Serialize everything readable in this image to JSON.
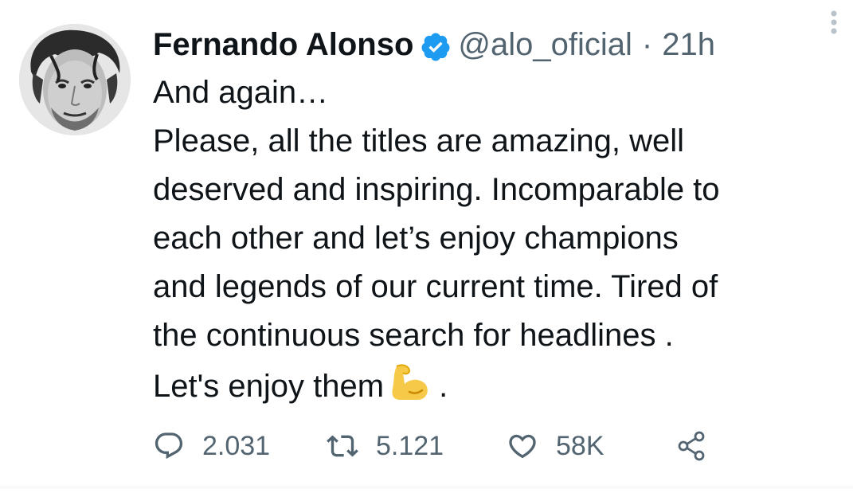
{
  "tweet": {
    "author_name": "Fernando Alonso",
    "handle": "@alo_oficial",
    "separator": "·",
    "time": "21h",
    "verified": true,
    "text_lines": [
      "And again…",
      "Please, all the titles are amazing, well",
      "deserved and inspiring. Incomparable to",
      "each other and let’s enjoy champions",
      "and legends of our current time. Tired of",
      "the continuous search for headlines .",
      "Let's enjoy them"
    ],
    "text_end": " .",
    "emoji": "flexed-biceps-emoji"
  },
  "actions": {
    "reply_count": "2.031",
    "retweet_count": "5.121",
    "like_count": "58K"
  },
  "colors": {
    "verified_blue": "#1d9bf0",
    "secondary_text": "#536471",
    "primary_text": "#0f1419",
    "emoji_yellow": "#f7c948"
  },
  "icons": [
    "reply-icon",
    "retweet-icon",
    "like-icon",
    "share-icon",
    "more-icon",
    "verified-badge-icon"
  ]
}
